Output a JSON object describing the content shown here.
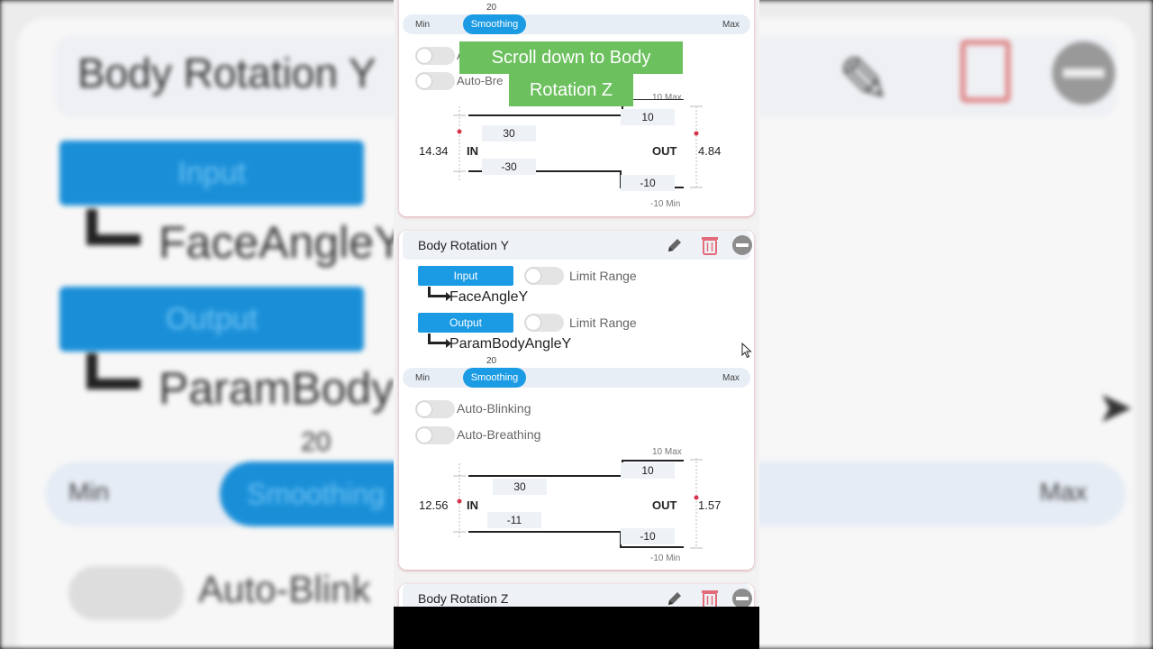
{
  "background": {
    "title": "Body Rotation Y",
    "input_label": "Input",
    "input_param": "FaceAngleY",
    "output_label": "Output",
    "output_param": "ParamBody",
    "smoothing_value": "20",
    "min_label": "Min",
    "smoothing_label": "Smoothing",
    "max_label": "Max",
    "auto_label": "Auto-Blink"
  },
  "overlay": {
    "line1": "Scroll down to Body",
    "line2": "Rotation Z"
  },
  "top_card": {
    "smoothing_value": "20",
    "min_label": "Min",
    "smoothing_label": "Smoothing",
    "max_label": "Max",
    "auto_blinking_partial": "A",
    "auto_breathing_partial": "Auto-Bre",
    "in_label": "IN",
    "out_label": "OUT",
    "in_value": "14.34",
    "out_value": "4.84",
    "in_max": "30",
    "in_min": "-30",
    "out_max": "10",
    "out_min": "-10",
    "out_max_caption": "10 Max",
    "out_min_caption": "-10 Min"
  },
  "card_y": {
    "title": "Body Rotation Y",
    "input_label": "Input",
    "input_param": "FaceAngleY",
    "output_label": "Output",
    "output_param": "ParamBodyAngleY",
    "limit_range": "Limit Range",
    "smoothing_value": "20",
    "min_label": "Min",
    "smoothing_label": "Smoothing",
    "max_label": "Max",
    "auto_blinking": "Auto-Blinking",
    "auto_breathing": "Auto-Breathing",
    "in_label": "IN",
    "out_label": "OUT",
    "in_value": "12.56",
    "out_value": "1.57",
    "in_max": "30",
    "in_min": "-11",
    "out_max": "10",
    "out_min": "-10",
    "out_max_caption": "10 Max",
    "out_min_caption": "-10 Min"
  },
  "card_z": {
    "title": "Body Rotation Z"
  },
  "colors": {
    "accent": "#1b9be4",
    "overlay_green": "#6cc05e",
    "trash_red": "#e36a78",
    "marker_red": "#d6334c"
  }
}
